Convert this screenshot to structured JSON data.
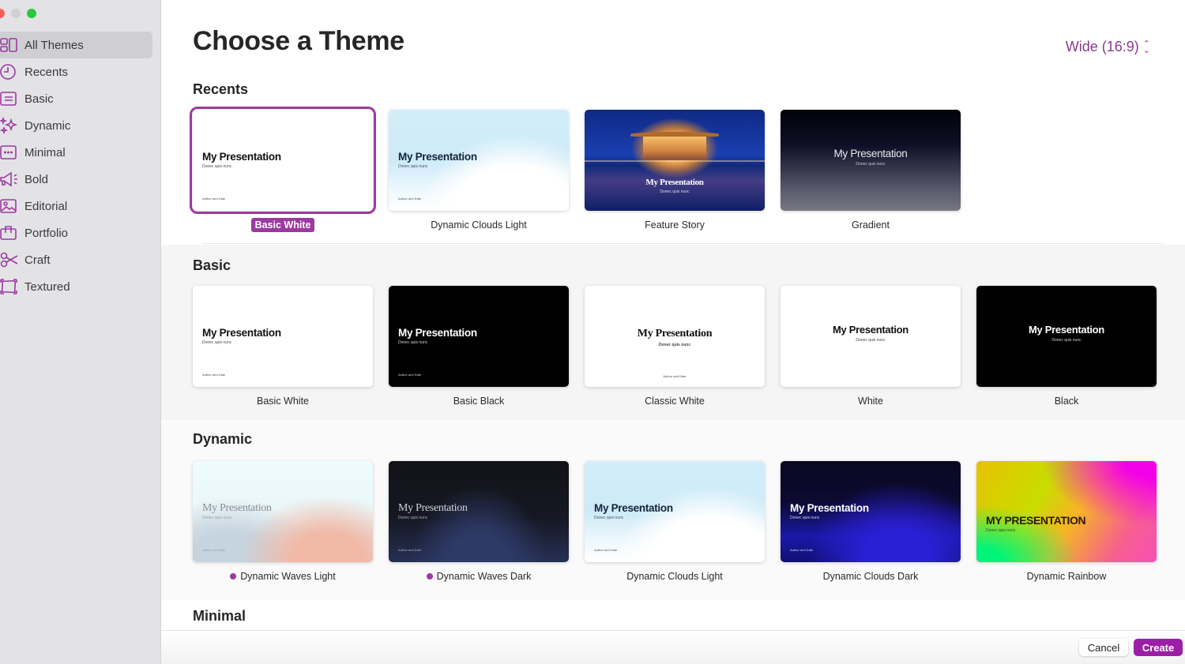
{
  "window": {
    "traffic_lights": [
      "close",
      "minimize",
      "maximize"
    ]
  },
  "sidebar": {
    "items": [
      {
        "label": "All Themes",
        "icon": "grid-icon",
        "active": true
      },
      {
        "label": "Recents",
        "icon": "clock-icon",
        "active": false
      },
      {
        "label": "Basic",
        "icon": "basic-slide-icon",
        "active": false
      },
      {
        "label": "Dynamic",
        "icon": "sparkles-icon",
        "active": false
      },
      {
        "label": "Minimal",
        "icon": "ellipsis-slide-icon",
        "active": false
      },
      {
        "label": "Bold",
        "icon": "megaphone-icon",
        "active": false
      },
      {
        "label": "Editorial",
        "icon": "photo-icon",
        "active": false
      },
      {
        "label": "Portfolio",
        "icon": "briefcase-icon",
        "active": false
      },
      {
        "label": "Craft",
        "icon": "scissors-icon",
        "active": false
      },
      {
        "label": "Textured",
        "icon": "textured-frame-icon",
        "active": false
      }
    ]
  },
  "header": {
    "title": "Choose a Theme",
    "slide_size": "Wide (16:9)"
  },
  "accent_color": "#9b3aa0",
  "slide_text": {
    "title": "My Presentation",
    "title_caps": "MY PRESENTATION",
    "subtitle": "Donec quis nunc",
    "author": "Author and Date"
  },
  "sections": {
    "recents": {
      "title": "Recents",
      "themes": [
        {
          "name": "Basic White",
          "selected": true
        },
        {
          "name": "Dynamic Clouds Light"
        },
        {
          "name": "Feature Story"
        },
        {
          "name": "Gradient"
        }
      ]
    },
    "basic": {
      "title": "Basic",
      "themes": [
        {
          "name": "Basic White"
        },
        {
          "name": "Basic Black"
        },
        {
          "name": "Classic White"
        },
        {
          "name": "White"
        },
        {
          "name": "Black"
        }
      ]
    },
    "dynamic": {
      "title": "Dynamic",
      "themes": [
        {
          "name": "Dynamic Waves Light",
          "new_badge": true
        },
        {
          "name": "Dynamic Waves Dark",
          "new_badge": true
        },
        {
          "name": "Dynamic Clouds Light"
        },
        {
          "name": "Dynamic Clouds Dark"
        },
        {
          "name": "Dynamic Rainbow"
        }
      ]
    },
    "minimal": {
      "title": "Minimal"
    }
  },
  "footer": {
    "cancel_label": "Cancel",
    "create_label": "Create"
  }
}
